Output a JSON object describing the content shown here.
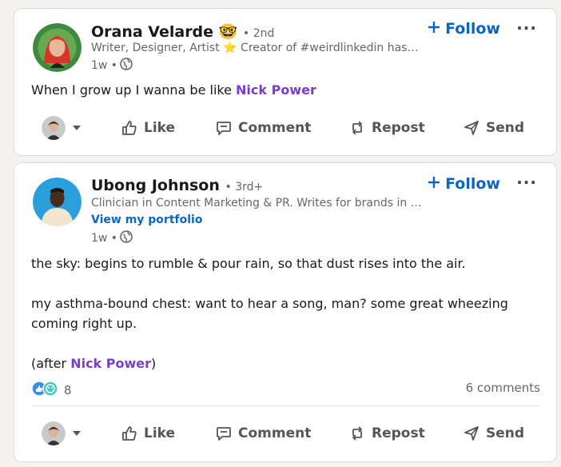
{
  "colors": {
    "accent": "#0a66c2",
    "mention": "#7b3ec9",
    "page_bg": "#f4f2ee"
  },
  "posts": [
    {
      "author": {
        "name": "Orana Velarde",
        "emoji": "🤓",
        "degree": "• 2nd",
        "headline": "Writer, Designer, Artist ⭐ Creator of #weirdlinkedin hashtag",
        "avatar_icon": "avatar-red-hair"
      },
      "meta": {
        "time": "1w •",
        "visibility_icon": "globe-icon"
      },
      "follow_label": "Follow",
      "more_label": "···",
      "body": {
        "text_before": "When I grow up I wanna be like ",
        "mention": "Nick Power"
      },
      "actions": {
        "like": "Like",
        "comment": "Comment",
        "repost": "Repost",
        "send": "Send"
      }
    },
    {
      "author": {
        "name": "Ubong Johnson",
        "degree": "• 3rd+",
        "headline": "Clinician in Content Marketing & PR. Writes for brands in Healthcare",
        "portfolio_link": "View my portfolio",
        "avatar_icon": "avatar-blue-bg"
      },
      "meta": {
        "time": "1w •",
        "visibility_icon": "globe-icon"
      },
      "follow_label": "Follow",
      "more_label": "···",
      "body": {
        "line1": "the sky: begins to rumble & pour rain, so that dust rises into the air.",
        "line2": "my asthma-bound chest: want to hear a song, man? some great wheezing coming right up.",
        "line3_before": "(after ",
        "line3_mention": "Nick Power",
        "line3_after": ")"
      },
      "reactions": {
        "count": "8",
        "icons": [
          "like-icon",
          "support-icon"
        ]
      },
      "comments_count": "6 comments",
      "actions": {
        "like": "Like",
        "comment": "Comment",
        "repost": "Repost",
        "send": "Send"
      }
    }
  ]
}
